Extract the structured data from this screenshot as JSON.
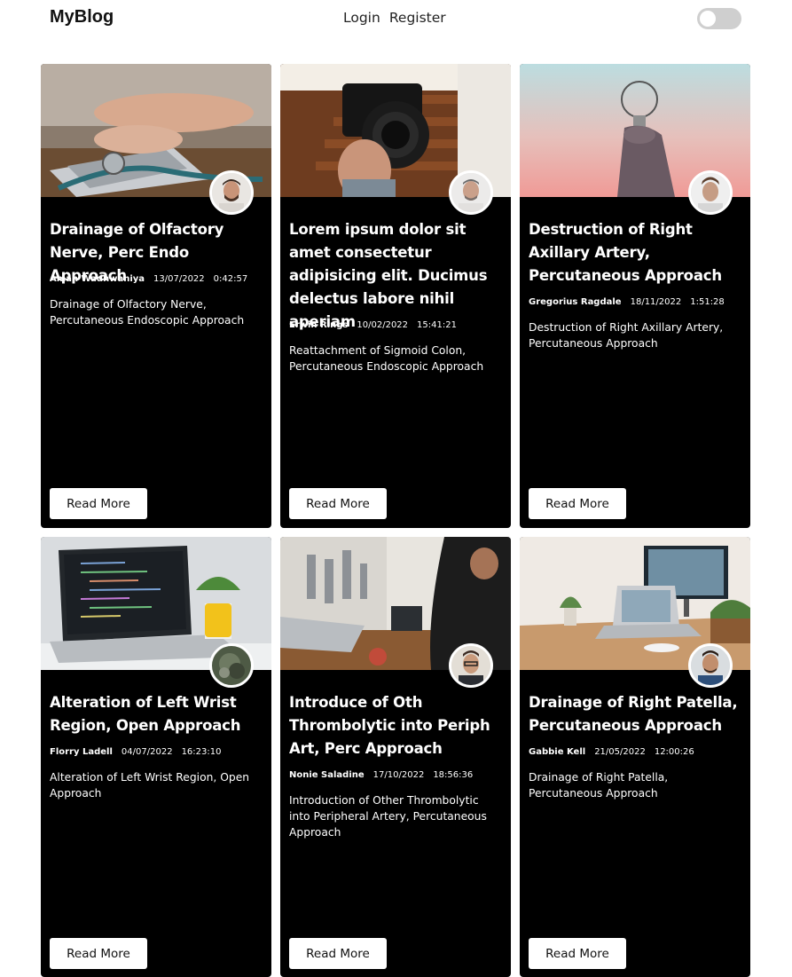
{
  "header": {
    "brand": "MyBlog",
    "nav": {
      "login": "Login",
      "register": "Register"
    },
    "theme_toggle_on": false
  },
  "colors": {
    "card_bg": "#000000",
    "text_on_card": "#ffffff",
    "toggle_track": "#cfcfcf"
  },
  "cards": [
    {
      "title": "Drainage of Olfactory Nerve, Perc Endo Approach",
      "author": "Aman Wadhwaniya",
      "date": "13/07/2022",
      "time": "0:42:57",
      "description": "Drainage of Olfactory Nerve, Percutaneous Endoscopic Approach",
      "button": "Read More",
      "image_icon": "laptop-stethoscope-photo",
      "avatar_icon": "author-avatar"
    },
    {
      "title": "Lorem ipsum dolor sit amet consectetur adipisicing elit. Ducimus delectus labore nihil aperiam",
      "author": "Erwin Rings",
      "date": "10/02/2022",
      "time": "15:41:21",
      "description": "Reattachment of Sigmoid Colon, Percutaneous Endoscopic Approach",
      "button": "Read More",
      "image_icon": "camera-photo",
      "avatar_icon": "author-avatar"
    },
    {
      "title": "Destruction of Right Axillary Artery, Percutaneous Approach",
      "author": "Gregorius Ragdale",
      "date": "18/11/2022",
      "time": "1:51:28",
      "description": "Destruction of Right Axillary Artery, Percutaneous Approach",
      "button": "Read More",
      "image_icon": "lightbulb-photo",
      "avatar_icon": "author-avatar"
    },
    {
      "title": "Alteration of Left Wrist Region, Open Approach",
      "author": "Florry Ladell",
      "date": "04/07/2022",
      "time": "16:23:10",
      "description": "Alteration of Left Wrist Region, Open Approach",
      "button": "Read More",
      "image_icon": "code-laptop-photo",
      "avatar_icon": "author-avatar"
    },
    {
      "title": "Introduce of Oth Thrombolytic into Periph Art, Perc Approach",
      "author": "Nonie Saladine",
      "date": "17/10/2022",
      "time": "18:56:36",
      "description": "Introduction of Other Thrombolytic into Peripheral Artery, Percutaneous Approach",
      "button": "Read More",
      "image_icon": "kitchen-photo",
      "avatar_icon": "author-avatar"
    },
    {
      "title": "Drainage of Right Patella, Percutaneous Approach",
      "author": "Gabbie Kell",
      "date": "21/05/2022",
      "time": "12:00:26",
      "description": "Drainage of Right Patella, Percutaneous Approach",
      "button": "Read More",
      "image_icon": "desk-setup-photo",
      "avatar_icon": "author-avatar"
    }
  ]
}
